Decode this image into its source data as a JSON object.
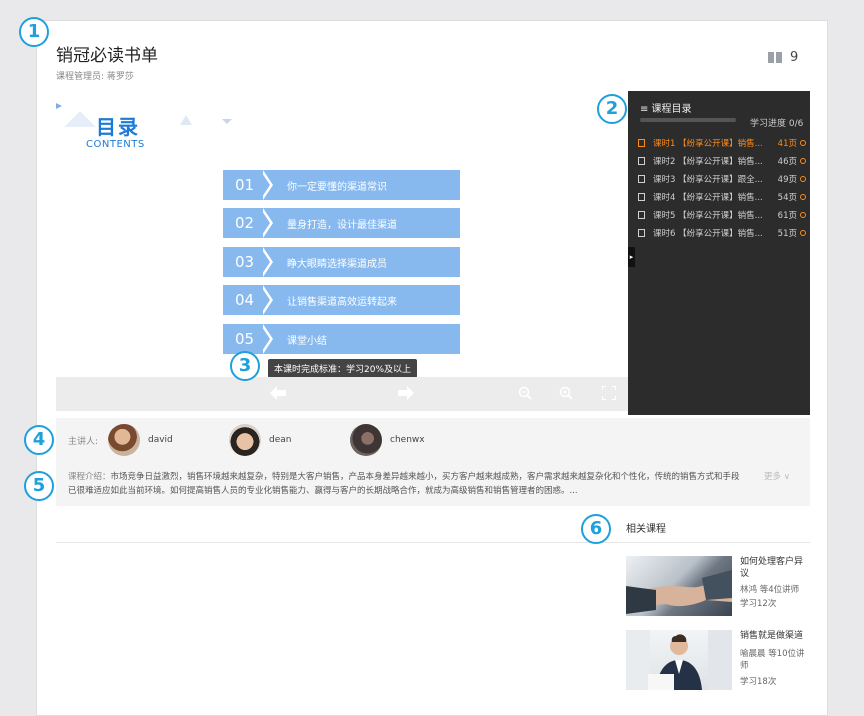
{
  "markers": [
    "1",
    "2",
    "3",
    "4",
    "5",
    "6"
  ],
  "course": {
    "title": "销冠必读书单",
    "manager": "课程管理员: 蒋罗莎",
    "book_count": "9",
    "book_icon": "book-icon"
  },
  "slide": {
    "heading": "目录",
    "subheading": "CONTENTS",
    "items": [
      {
        "num": "01",
        "text": "你一定要懂的渠道常识"
      },
      {
        "num": "02",
        "text": "量身打造，设计最佳渠道"
      },
      {
        "num": "03",
        "text": "睁大眼睛选择渠道成员"
      },
      {
        "num": "04",
        "text": "让销售渠道高效运转起来"
      },
      {
        "num": "05",
        "text": "课堂小结"
      }
    ],
    "tooltip": "本课时完成标准：学习20%及以上"
  },
  "viewer_controls": {
    "prev_icon": "arrow-left-icon",
    "next_icon": "arrow-right-icon",
    "zoom_out_icon": "zoom-out-icon",
    "zoom_in_icon": "zoom-in-icon",
    "fullscreen_icon": "fullscreen-icon"
  },
  "catalog": {
    "title": "≡ 课程目录",
    "progress_label": "学习进度 0/6",
    "progress_value": 0,
    "lessons": [
      {
        "title": "课时1 【纷享公开课】销售...",
        "pages": "41页",
        "active": true
      },
      {
        "title": "课时2 【纷享公开课】销售...",
        "pages": "46页",
        "active": false
      },
      {
        "title": "课时3 【纷享公开课】跟全...",
        "pages": "49页",
        "active": false
      },
      {
        "title": "课时4 【纷享公开课】销售...",
        "pages": "54页",
        "active": false
      },
      {
        "title": "课时5 【纷享公开课】销售...",
        "pages": "61页",
        "active": false
      },
      {
        "title": "课时6 【纷享公开课】销售...",
        "pages": "51页",
        "active": false
      }
    ]
  },
  "lecturers": {
    "label": "主讲人:",
    "people": [
      {
        "name": "david"
      },
      {
        "name": "dean"
      },
      {
        "name": "chenwx"
      }
    ]
  },
  "intro": {
    "label": "课程介绍：",
    "text": "市场竞争日益激烈，销售环境越来越复杂，特别是大客户销售，产品本身差异越来越小，买方客户越来越成熟，客户需求越来越复杂化和个性化，传统的销售方式和手段已很难适应如此当前环境。如何提高销售人员的专业化销售能力、赢得与客户的长期战略合作，就成为高级销售和销售管理者的困惑。...",
    "more": "更多 ∨"
  },
  "related": {
    "title": "相关课程",
    "courses": [
      {
        "name": "如何处理客户异议",
        "teachers": "林鸿 等4位讲师",
        "views": "学习12次"
      },
      {
        "name": "销售就是做渠道",
        "teachers": "喻晨晨 等10位讲师",
        "views": "学习18次"
      }
    ]
  }
}
